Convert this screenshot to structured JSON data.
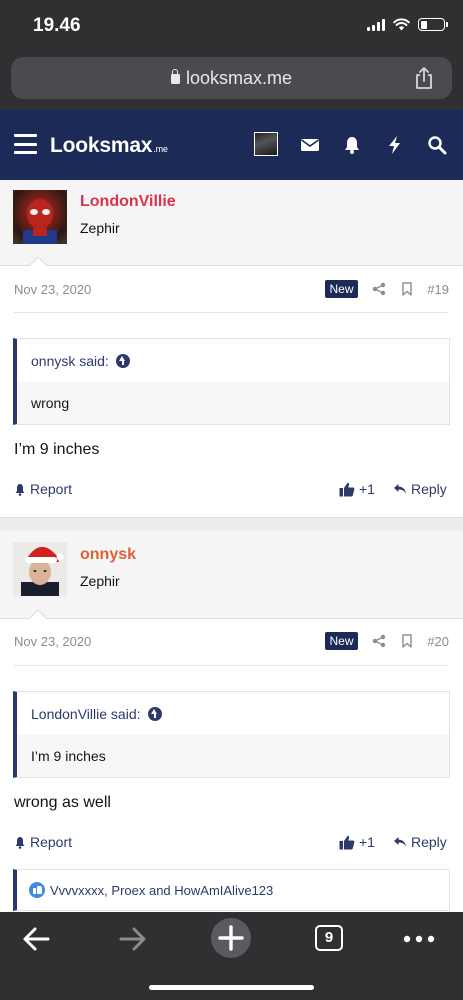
{
  "status_bar": {
    "time": "19.46"
  },
  "browser": {
    "url": "looksmax.me"
  },
  "site": {
    "logo_main": "Looksmax",
    "logo_suffix": ".me"
  },
  "posts": [
    {
      "username": "LondonVillie",
      "username_color": "#d9334f",
      "user_title": "Zephir",
      "date": "Nov 23, 2020",
      "badge": "New",
      "number": "#19",
      "quote_author": "onnysk said:",
      "quote_text": "wrong",
      "text": "I’m 9 inches",
      "report_label": "Report",
      "like_count": "+1",
      "reply_label": "Reply"
    },
    {
      "username": "onnysk",
      "username_color": "#e0603a",
      "user_title": "Zephir",
      "date": "Nov 23, 2020",
      "badge": "New",
      "number": "#20",
      "quote_author": "LondonVillie said:",
      "quote_text": "I’m 9 inches",
      "text": "wrong as well",
      "report_label": "Report",
      "like_count": "+1",
      "reply_label": "Reply"
    }
  ],
  "reactions_text": "Vvvvxxxx, Proex and HowAmIAlive123",
  "toolbar": {
    "tab_count": "9"
  },
  "colors": {
    "nav": "#1b2a57",
    "accent": "#2b3a6b",
    "ios_bar": "#2f3032"
  }
}
